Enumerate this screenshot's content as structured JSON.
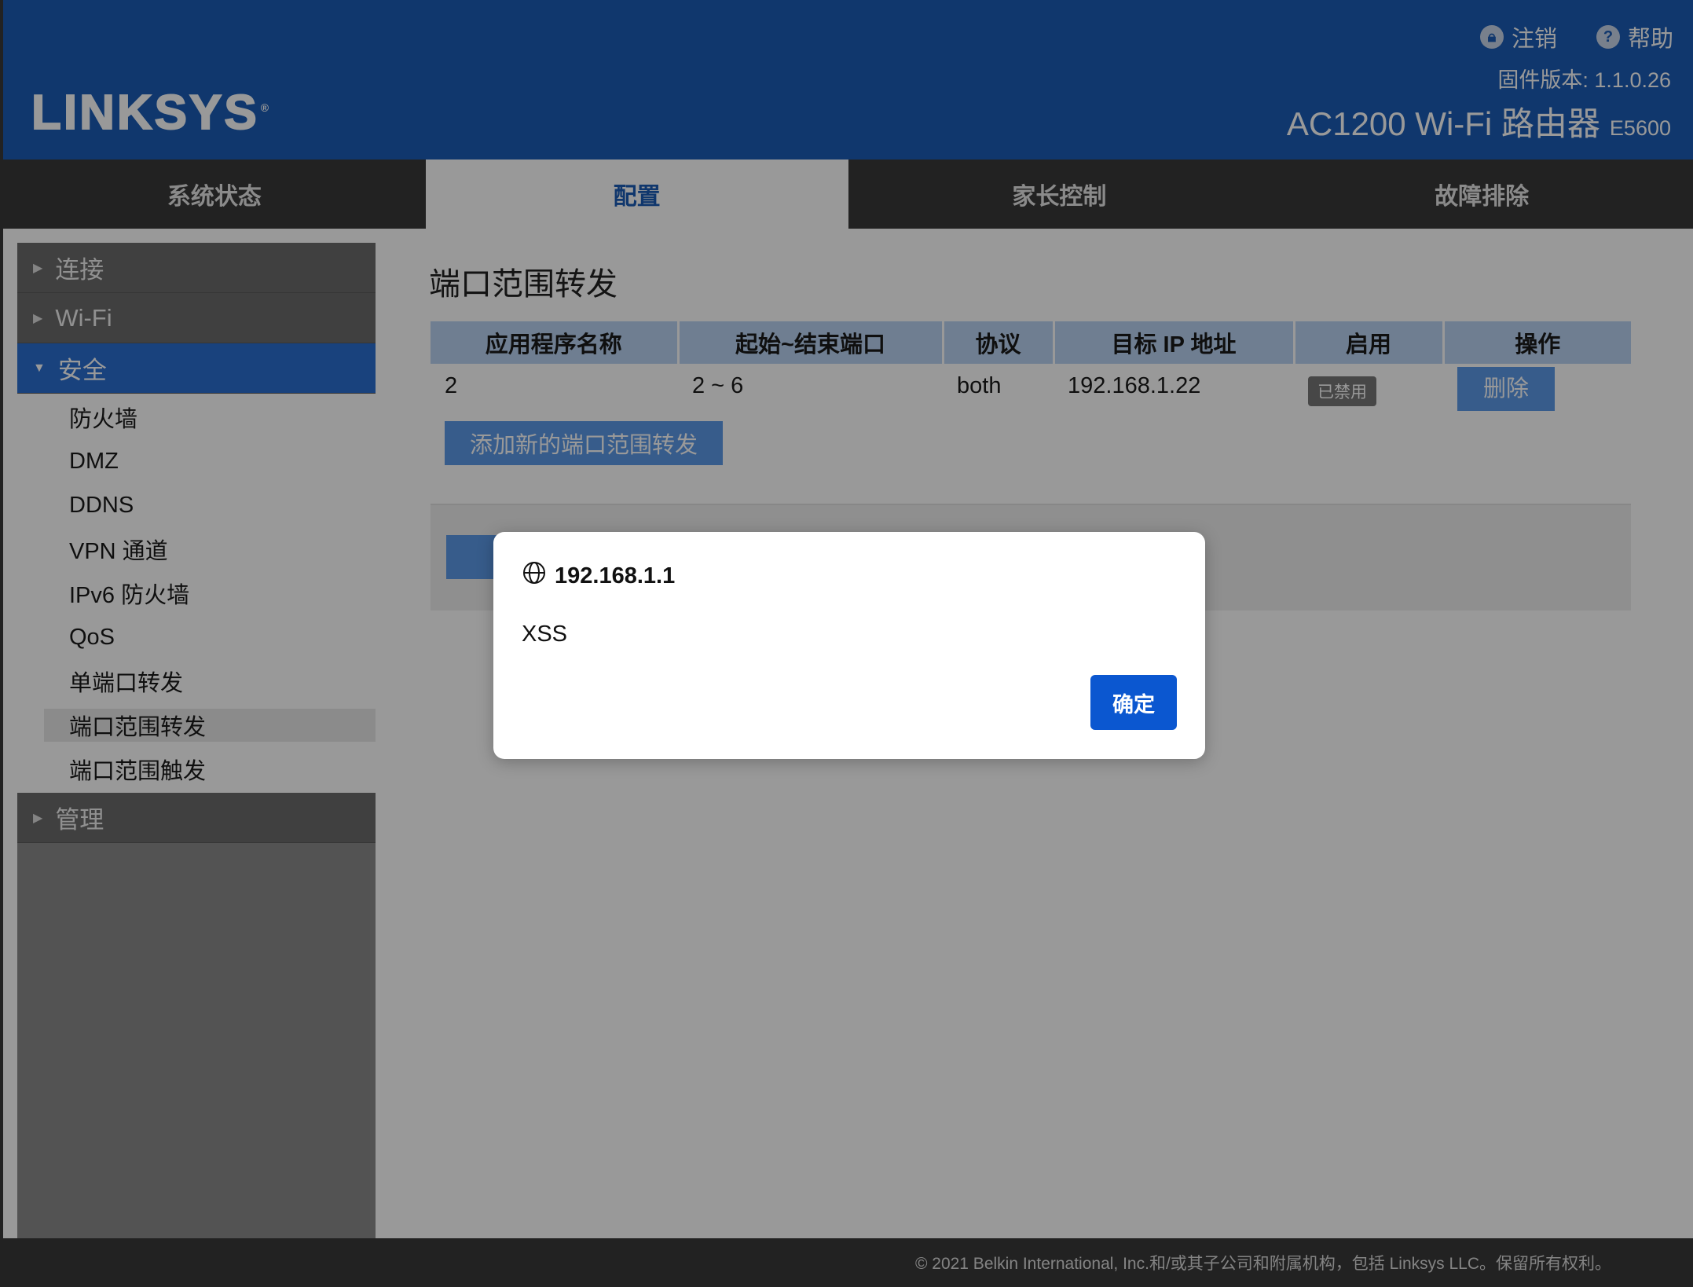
{
  "header": {
    "logo": "LINKSYS",
    "logout_label": "注销",
    "help_label": "帮助",
    "firmware": "固件版本: 1.1.0.26",
    "product_name": "AC1200 Wi-Fi 路由器",
    "model": "E5600",
    "logout_icon": "lock-icon",
    "help_icon": "help-icon"
  },
  "tabs": [
    {
      "label": "系统状态"
    },
    {
      "label": "配置"
    },
    {
      "label": "家长控制"
    },
    {
      "label": "故障排除"
    }
  ],
  "sidebar": {
    "sections": [
      {
        "label": "连接"
      },
      {
        "label": "Wi-Fi"
      },
      {
        "label": "安全"
      },
      {
        "label": "管理"
      }
    ],
    "security_items": [
      {
        "label": "防火墙"
      },
      {
        "label": "DMZ"
      },
      {
        "label": "DDNS"
      },
      {
        "label": "VPN 通道"
      },
      {
        "label": "IPv6 防火墙"
      },
      {
        "label": "QoS"
      },
      {
        "label": "单端口转发"
      },
      {
        "label": "端口范围转发"
      },
      {
        "label": "端口范围触发"
      }
    ]
  },
  "main": {
    "title": "端口范围转发",
    "columns": [
      "应用程序名称",
      "起始~结束端口",
      "协议",
      "目标 IP 地址",
      "启用",
      "操作"
    ],
    "rows": [
      {
        "app": "2",
        "ports": "2 ~ 6",
        "protocol": "both",
        "ip": "192.168.1.22",
        "enabled": "已禁用",
        "action": "删除"
      }
    ],
    "add_label": "添加新的端口范围转发"
  },
  "footer": {
    "copyright": "© 2021 Belkin International, Inc.和/或其子公司和附属机构，包括 Linksys LLC。保留所有权利。"
  },
  "dialog": {
    "origin": "192.168.1.1",
    "message": "XSS",
    "ok_label": "确定",
    "origin_icon": "globe-icon"
  }
}
